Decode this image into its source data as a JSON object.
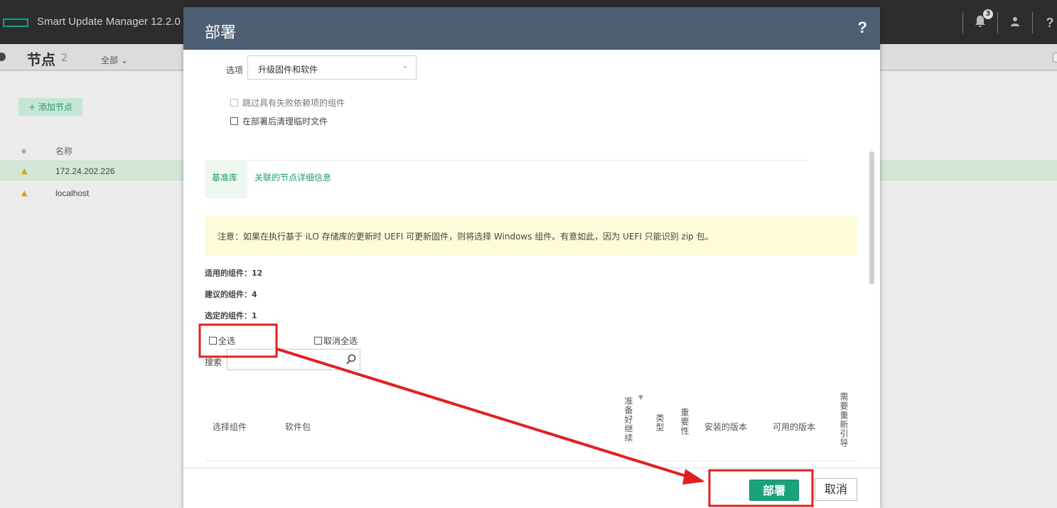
{
  "app": {
    "title": "Smart Update Manager 12.2.0",
    "notification_count": "3",
    "icons": [
      "bell-icon",
      "user-icon",
      "help-icon"
    ]
  },
  "subbar": {
    "title": "节点",
    "count": "2",
    "filter": "全部 ⌄"
  },
  "left_panel": {
    "add_node": "+ 添加节点",
    "column_name": "名称",
    "nodes": [
      {
        "name": "172.24.202.226",
        "status": "warning"
      },
      {
        "name": "localhost",
        "status": "warning"
      }
    ]
  },
  "modal": {
    "title": "部署",
    "help": "?",
    "option_label": "选项",
    "option_value": "升级固件和软件",
    "checkbox_skip": "跳过具有失败依赖项的组件",
    "checkbox_cleanup": "在部署后清理临时文件",
    "tabs": [
      "基准库",
      "关联的节点详细信息"
    ],
    "note": "注意：如果在执行基于 iLO 存储库的更新时 UEFI 可更新固件，则将选择 Windows 组件。有意如此，因为 UEFI 只能识别 zip 包。",
    "applicable": "适用的组件：12",
    "recommended": "建议的组件：4",
    "selected": "选定的组件：1",
    "select_all": "全选",
    "deselect_all": "取消全选",
    "search_label": "搜索",
    "search_value": "",
    "columns": {
      "select": "选择组件",
      "package": "软件包",
      "ready": "准备好继续",
      "type": "类型",
      "importance": "重要性",
      "installed": "安装的版本",
      "available": "可用的版本",
      "reboot": "需要重新引导"
    },
    "deploy": "部署",
    "cancel": "取消"
  },
  "colors": {
    "accent": "#1aa37b",
    "header": "#4d5f74",
    "annotation": "#e02020",
    "note_bg": "#fdfbd8"
  }
}
